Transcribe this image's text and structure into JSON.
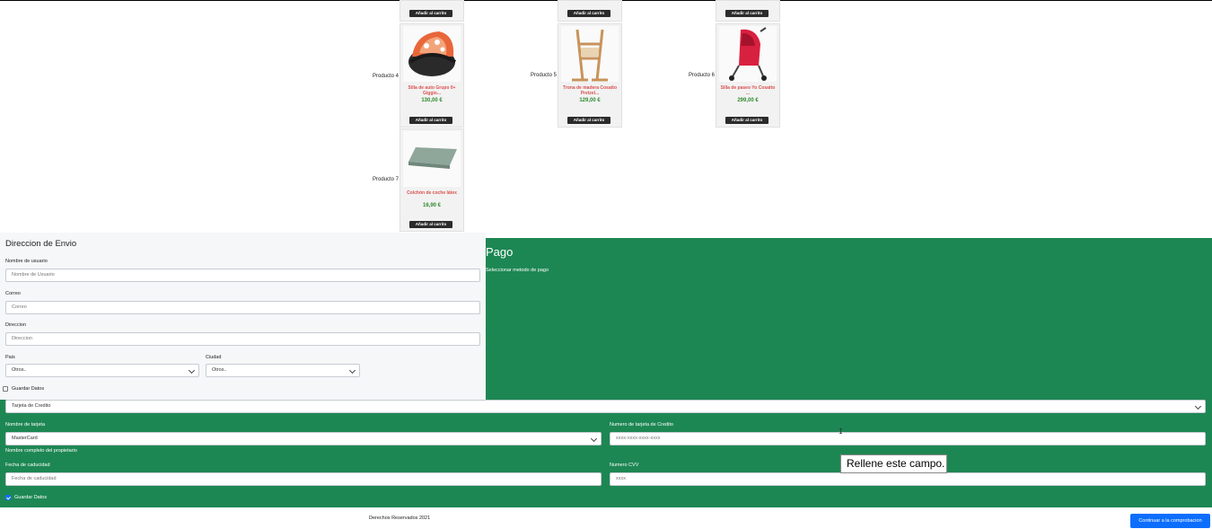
{
  "colors": {
    "accent": "#1d8753",
    "button": "#0d6efd",
    "product_name": "#d9534f",
    "price": "#2e8b2e"
  },
  "products": {
    "add_label": "Añadir al carrito",
    "items": [
      {
        "label": "Producto 4",
        "name": "Silla de auto Grupo 0+ Giggio...",
        "price": "130,00 €",
        "icon": "car-seat-image"
      },
      {
        "label": "Producto 5",
        "name": "Trona de madera Cosatto Pretzel...",
        "price": "129,00 €",
        "icon": "high-chair-image"
      },
      {
        "label": "Producto 6",
        "name": "Silla de paseo Yo Cosatto ...",
        "price": "299,00 €",
        "icon": "stroller-image"
      },
      {
        "label": "Producto 7",
        "name": "Colchón de coche látex",
        "price": "16,90 €",
        "icon": "mattress-image"
      }
    ]
  },
  "shipping": {
    "title": "Direccion de Envio",
    "username_label": "Nombre de usuario",
    "username_placeholder": "Nombre de Usuario",
    "email_label": "Correo",
    "email_placeholder": "Correo",
    "address_label": "Direccion",
    "address_placeholder": "Direccion",
    "country_label": "Pais",
    "country_value": "Otros..",
    "city_label": "Ciudad",
    "city_value": "Otros..",
    "save_label": "Guardar Datos"
  },
  "payment": {
    "title": "Pago",
    "method_label": "Seleccionar metodo de pago",
    "method_value": "Tarjeta de Credito",
    "card_name_label": "Nombre de tarjeta",
    "card_name_value": "MasterCard",
    "card_name_help": "Nombre completo del propietario",
    "card_number_label": "Numero de tarjeta de Credito",
    "card_number_placeholder": "xxxx-xxxx-xxxx-xxxx",
    "expiry_label": "Fecha de caducidad",
    "expiry_placeholder": "Fecha de caducidad",
    "cvv_label": "Numero CVV",
    "cvv_placeholder": "xxxx",
    "save_label": "Guardar Datos"
  },
  "tooltip": "Rellene este campo.",
  "footer": {
    "copyright": "Derechos Reservados 2021",
    "continue_label": "Continuar a la comprobacion"
  }
}
